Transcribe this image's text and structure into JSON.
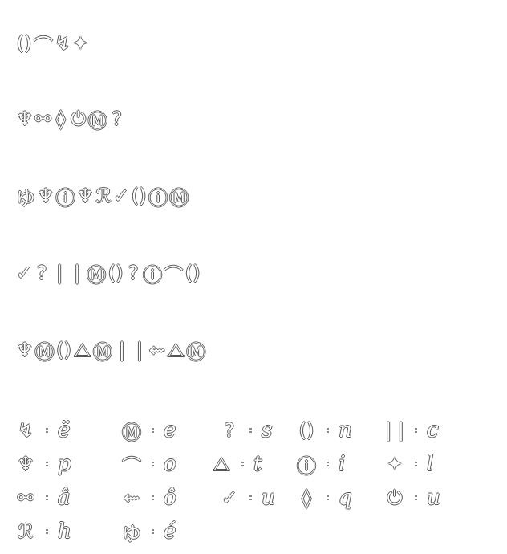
{
  "rows": [
    [
      "()",
      "⌒",
      "↯",
      "✦"
    ],
    [
      "♆",
      "⚯",
      "◊",
      "⏻",
      "Ⓜ",
      "?"
    ],
    [
      "ゆ",
      "♆",
      "ⓘ",
      "♆",
      "ℛ",
      "✓",
      "()",
      "ⓘ",
      "Ⓜ"
    ],
    [
      "✓",
      "?",
      "|",
      "|",
      "Ⓜ",
      "()",
      "?",
      "ⓘ",
      "⌒",
      "()"
    ],
    [
      "♆",
      "Ⓜ",
      "()",
      "⧍",
      "Ⓜ",
      "|",
      "|",
      "⇜",
      "⧍",
      "Ⓜ"
    ]
  ],
  "legend": [
    [
      {
        "symbol": "↯",
        "letter": "ë"
      },
      {
        "symbol": "Ⓜ",
        "letter": "e"
      },
      {
        "symbol": "?",
        "letter": "s"
      },
      {
        "symbol": "()",
        "letter": "n"
      },
      {
        "symbol": "| |",
        "letter": "c"
      }
    ],
    [
      {
        "symbol": "♆",
        "letter": "p"
      },
      {
        "symbol": "⌒",
        "letter": "o"
      },
      {
        "symbol": "⧍",
        "letter": "t"
      },
      {
        "symbol": "ⓘ",
        "letter": "i"
      },
      {
        "symbol": "✦",
        "letter": "l"
      }
    ],
    [
      {
        "symbol": "⚯",
        "letter": "â"
      },
      {
        "symbol": "⇜",
        "letter": "ô"
      },
      {
        "symbol": "✓",
        "letter": "u"
      },
      {
        "symbol": "◊",
        "letter": "q"
      },
      {
        "symbol": "⏻",
        "letter": "u"
      }
    ],
    [
      {
        "symbol": "ℛ",
        "letter": "h"
      },
      {
        "symbol": "ゆ",
        "letter": "é"
      }
    ]
  ]
}
